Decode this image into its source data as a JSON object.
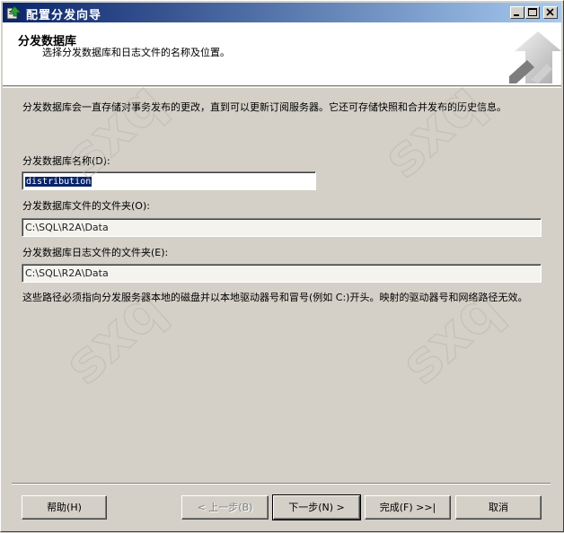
{
  "window": {
    "title": "配置分发向导"
  },
  "header": {
    "title": "分发数据库",
    "subtitle": "选择分发数据库和日志文件的名称及位置。"
  },
  "body": {
    "intro": "分发数据库会一直存储对事务发布的更改，直到可以更新订阅服务器。它还可存储快照和合并发布的历史信息。",
    "db_name_label": "分发数据库名称(D):",
    "db_name_value": "distribution",
    "db_folder_label": "分发数据库文件的文件夹(O):",
    "db_folder_value": "C:\\SQL\\R2A\\Data",
    "log_folder_label": "分发数据库日志文件的文件夹(E):",
    "log_folder_value": "C:\\SQL\\R2A\\Data",
    "note": "这些路径必须指向分发服务器本地的磁盘并以本地驱动器号和冒号(例如 C:)开头。映射的驱动器号和网络路径无效。"
  },
  "buttons": {
    "help": "帮助(H)",
    "back": "< 上一步(B)",
    "next": "下一步(N) >",
    "finish": "完成(F) >>|",
    "cancel": "取消"
  },
  "watermark": {
    "text": "sxq"
  },
  "icons": {
    "app": "wizard-app-icon",
    "minimize": "minimize-icon",
    "maximize": "maximize-icon",
    "close": "close-icon",
    "header": "wizard-header-graphic"
  }
}
